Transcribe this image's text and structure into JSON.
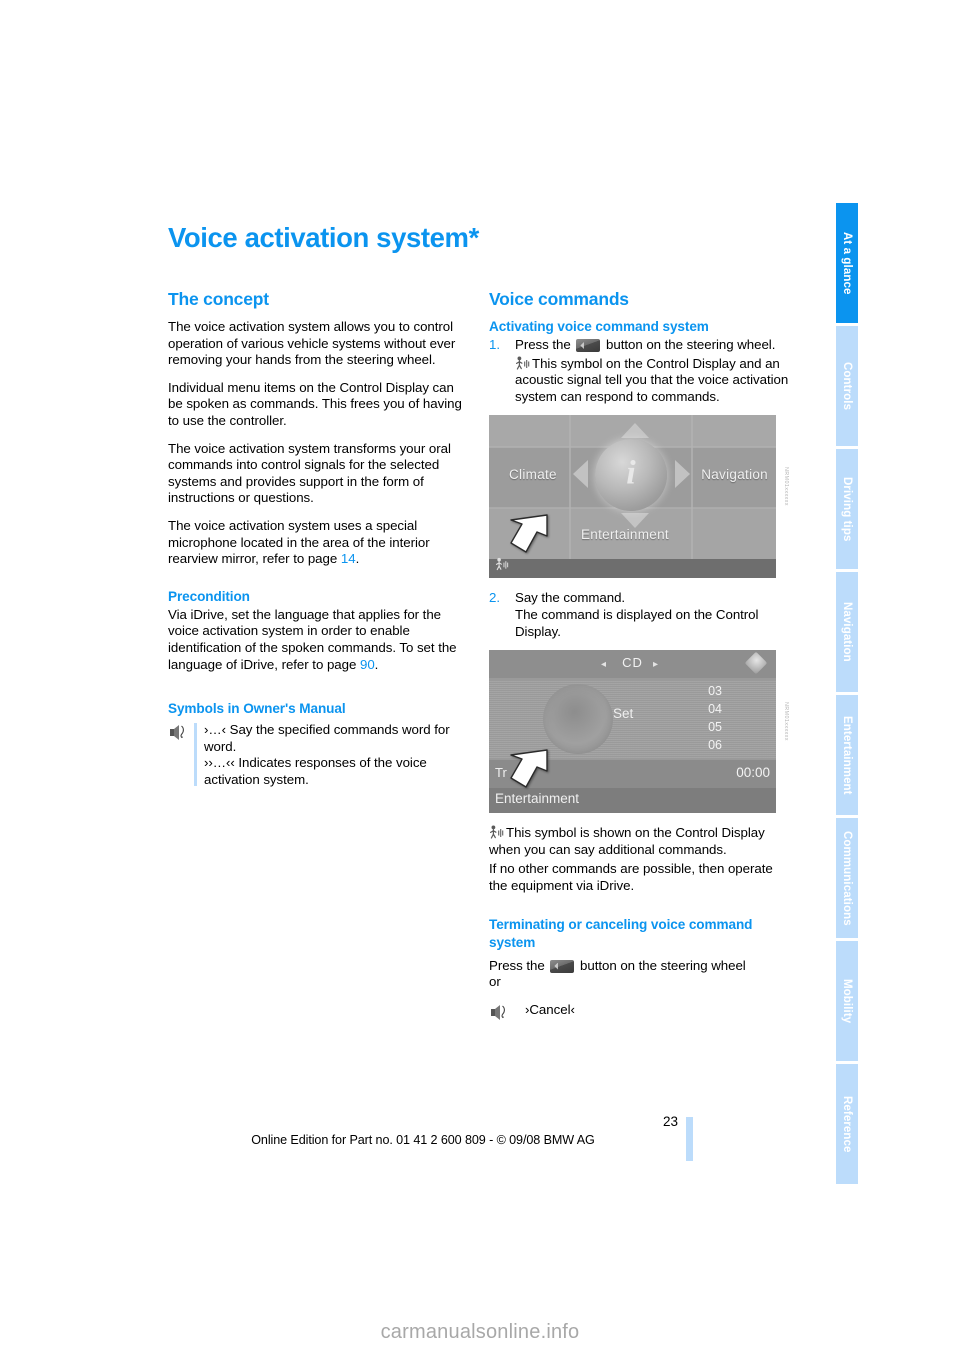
{
  "document": {
    "title": "Voice activation system*",
    "page_number": "23",
    "footer": "Online Edition for Part no. 01 41 2 600 809 - © 09/08 BMW AG",
    "watermark": "carmanualsonline.info"
  },
  "tabs": [
    {
      "label": "At a glance",
      "active": true
    },
    {
      "label": "Controls",
      "active": false
    },
    {
      "label": "Driving tips",
      "active": false
    },
    {
      "label": "Navigation",
      "active": false
    },
    {
      "label": "Entertainment",
      "active": false
    },
    {
      "label": "Communications",
      "active": false
    },
    {
      "label": "Mobility",
      "active": false
    },
    {
      "label": "Reference",
      "active": false
    }
  ],
  "colors": {
    "accent": "#0b94ef",
    "tab_inactive": "#bcdcfb",
    "rule": "#bcdcfb"
  },
  "left_column": {
    "concept": {
      "heading": "The concept",
      "paragraphs": [
        "The voice activation system allows you to control operation of various vehicle systems without ever removing your hands from the steering wheel.",
        "Individual menu items on the Control Display can be spoken as commands. This frees you of having to use the controller.",
        "The voice activation system transforms your oral commands into control signals for the selected systems and provides support in the form of instructions or questions."
      ],
      "microphone_text_before": "The voice activation system uses a special microphone located in the area of the interior rearview mirror, refer to page ",
      "microphone_page_ref": "14",
      "microphone_text_after": "."
    },
    "precondition": {
      "heading": "Precondition",
      "text_before": "Via iDrive, set the language that applies for the voice activation system in order to enable identification of the spoken commands. To set the language of iDrive, refer to page ",
      "page_ref": "90",
      "text_after": "."
    },
    "symbols": {
      "heading": "Symbols in Owner's Manual",
      "icon": "voice-command-icon",
      "line1": "›…‹ Say the specified commands word for word.",
      "line2": "››…‹‹ Indicates responses of the voice activation system."
    }
  },
  "right_column": {
    "heading": "Voice commands",
    "activating": {
      "heading": "Activating voice command system",
      "step1": {
        "number": "1.",
        "text_before": "Press the ",
        "icon": "steering-wheel-button-icon",
        "text_after": " button on the steering wheel.",
        "note_icon": "voice-active-symbol-icon",
        "note": "This symbol on the Control Display and an acoustic signal tell you that the voice activation system can respond to commands."
      },
      "step2": {
        "number": "2.",
        "line1": "Say the command.",
        "line2": "The command is displayed on the Control Display."
      }
    },
    "figure_menu": {
      "name": "idrive-main-menu-screenshot",
      "code": "NRM01xxxxxx",
      "labels": {
        "climate": "Climate",
        "navigation": "Navigation",
        "entertainment": "Entertainment",
        "center_icon": "i"
      },
      "pointer": "white-arrow-pointer",
      "status_icon": "voice-active-symbol-icon"
    },
    "figure_cd": {
      "name": "idrive-cd-screenshot",
      "code": "NRM01xxxxxx",
      "title": "CD",
      "arrow_left": "◂",
      "arrow_right": "▸",
      "set_label": "Set",
      "tracks": [
        "03",
        "04",
        "05",
        "06"
      ],
      "track_label": "Tr",
      "time": "00:00",
      "footer": "Entertainment",
      "pointer": "white-arrow-pointer"
    },
    "symbol_note": {
      "icon": "voice-active-symbol-icon",
      "line1": "This symbol is shown on the Control Display when you can say additional commands.",
      "line2": "If no other commands are possible, then operate the equipment via iDrive."
    },
    "terminating": {
      "heading": "Terminating or canceling voice command system",
      "text_before": "Press the ",
      "icon": "steering-wheel-button-icon",
      "text_after": " button on the steering wheel",
      "or": "or",
      "cancel_icon": "voice-command-icon",
      "cancel_command": "›Cancel‹"
    }
  }
}
